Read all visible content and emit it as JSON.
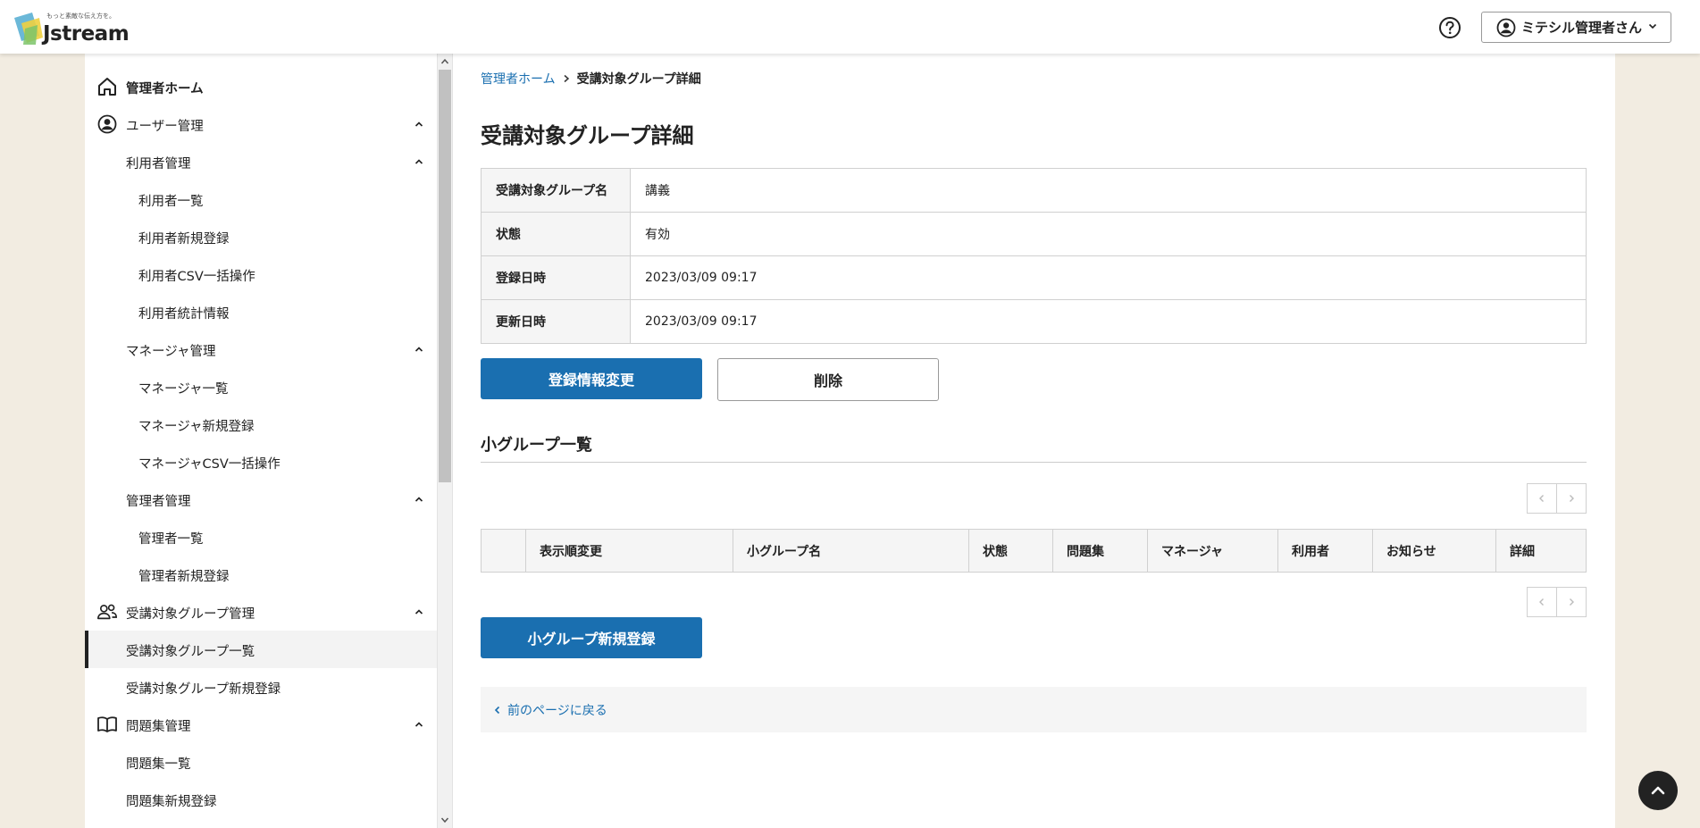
{
  "header": {
    "logo_tagline": "もっと素敵な伝え方を。",
    "logo_text": "Jstream",
    "user_name": "ミテシル管理者さん"
  },
  "sidebar": {
    "items": [
      {
        "label": "管理者ホーム"
      },
      {
        "label": "ユーザー管理"
      },
      {
        "label": "利用者管理"
      },
      {
        "label": "利用者一覧"
      },
      {
        "label": "利用者新規登録"
      },
      {
        "label": "利用者CSV一括操作"
      },
      {
        "label": "利用者統計情報"
      },
      {
        "label": "マネージャ管理"
      },
      {
        "label": "マネージャ一覧"
      },
      {
        "label": "マネージャ新規登録"
      },
      {
        "label": "マネージャCSV一括操作"
      },
      {
        "label": "管理者管理"
      },
      {
        "label": "管理者一覧"
      },
      {
        "label": "管理者新規登録"
      },
      {
        "label": "受講対象グループ管理"
      },
      {
        "label": "受講対象グループ一覧"
      },
      {
        "label": "受講対象グループ新規登録"
      },
      {
        "label": "問題集管理"
      },
      {
        "label": "問題集一覧"
      },
      {
        "label": "問題集新規登録"
      }
    ]
  },
  "breadcrumb": {
    "home": "管理者ホーム",
    "current": "受講対象グループ詳細"
  },
  "page_title": "受講対象グループ詳細",
  "details": [
    {
      "label": "受講対象グループ名",
      "value": "講義"
    },
    {
      "label": "状態",
      "value": "有効"
    },
    {
      "label": "登録日時",
      "value": "2023/03/09 09:17"
    },
    {
      "label": "更新日時",
      "value": "2023/03/09 09:17"
    }
  ],
  "actions": {
    "edit_label": "登録情報変更",
    "delete_label": "削除"
  },
  "subgroups": {
    "title": "小グループ一覧",
    "columns": [
      "",
      "表示順変更",
      "小グループ名",
      "状態",
      "問題集",
      "マネージャ",
      "利用者",
      "お知らせ",
      "詳細"
    ],
    "rows": [],
    "new_label": "小グループ新規登録"
  },
  "back_label": "前のページに戻る",
  "colors": {
    "accent": "#1a6fb0",
    "page_bg": "#f2ece1"
  }
}
